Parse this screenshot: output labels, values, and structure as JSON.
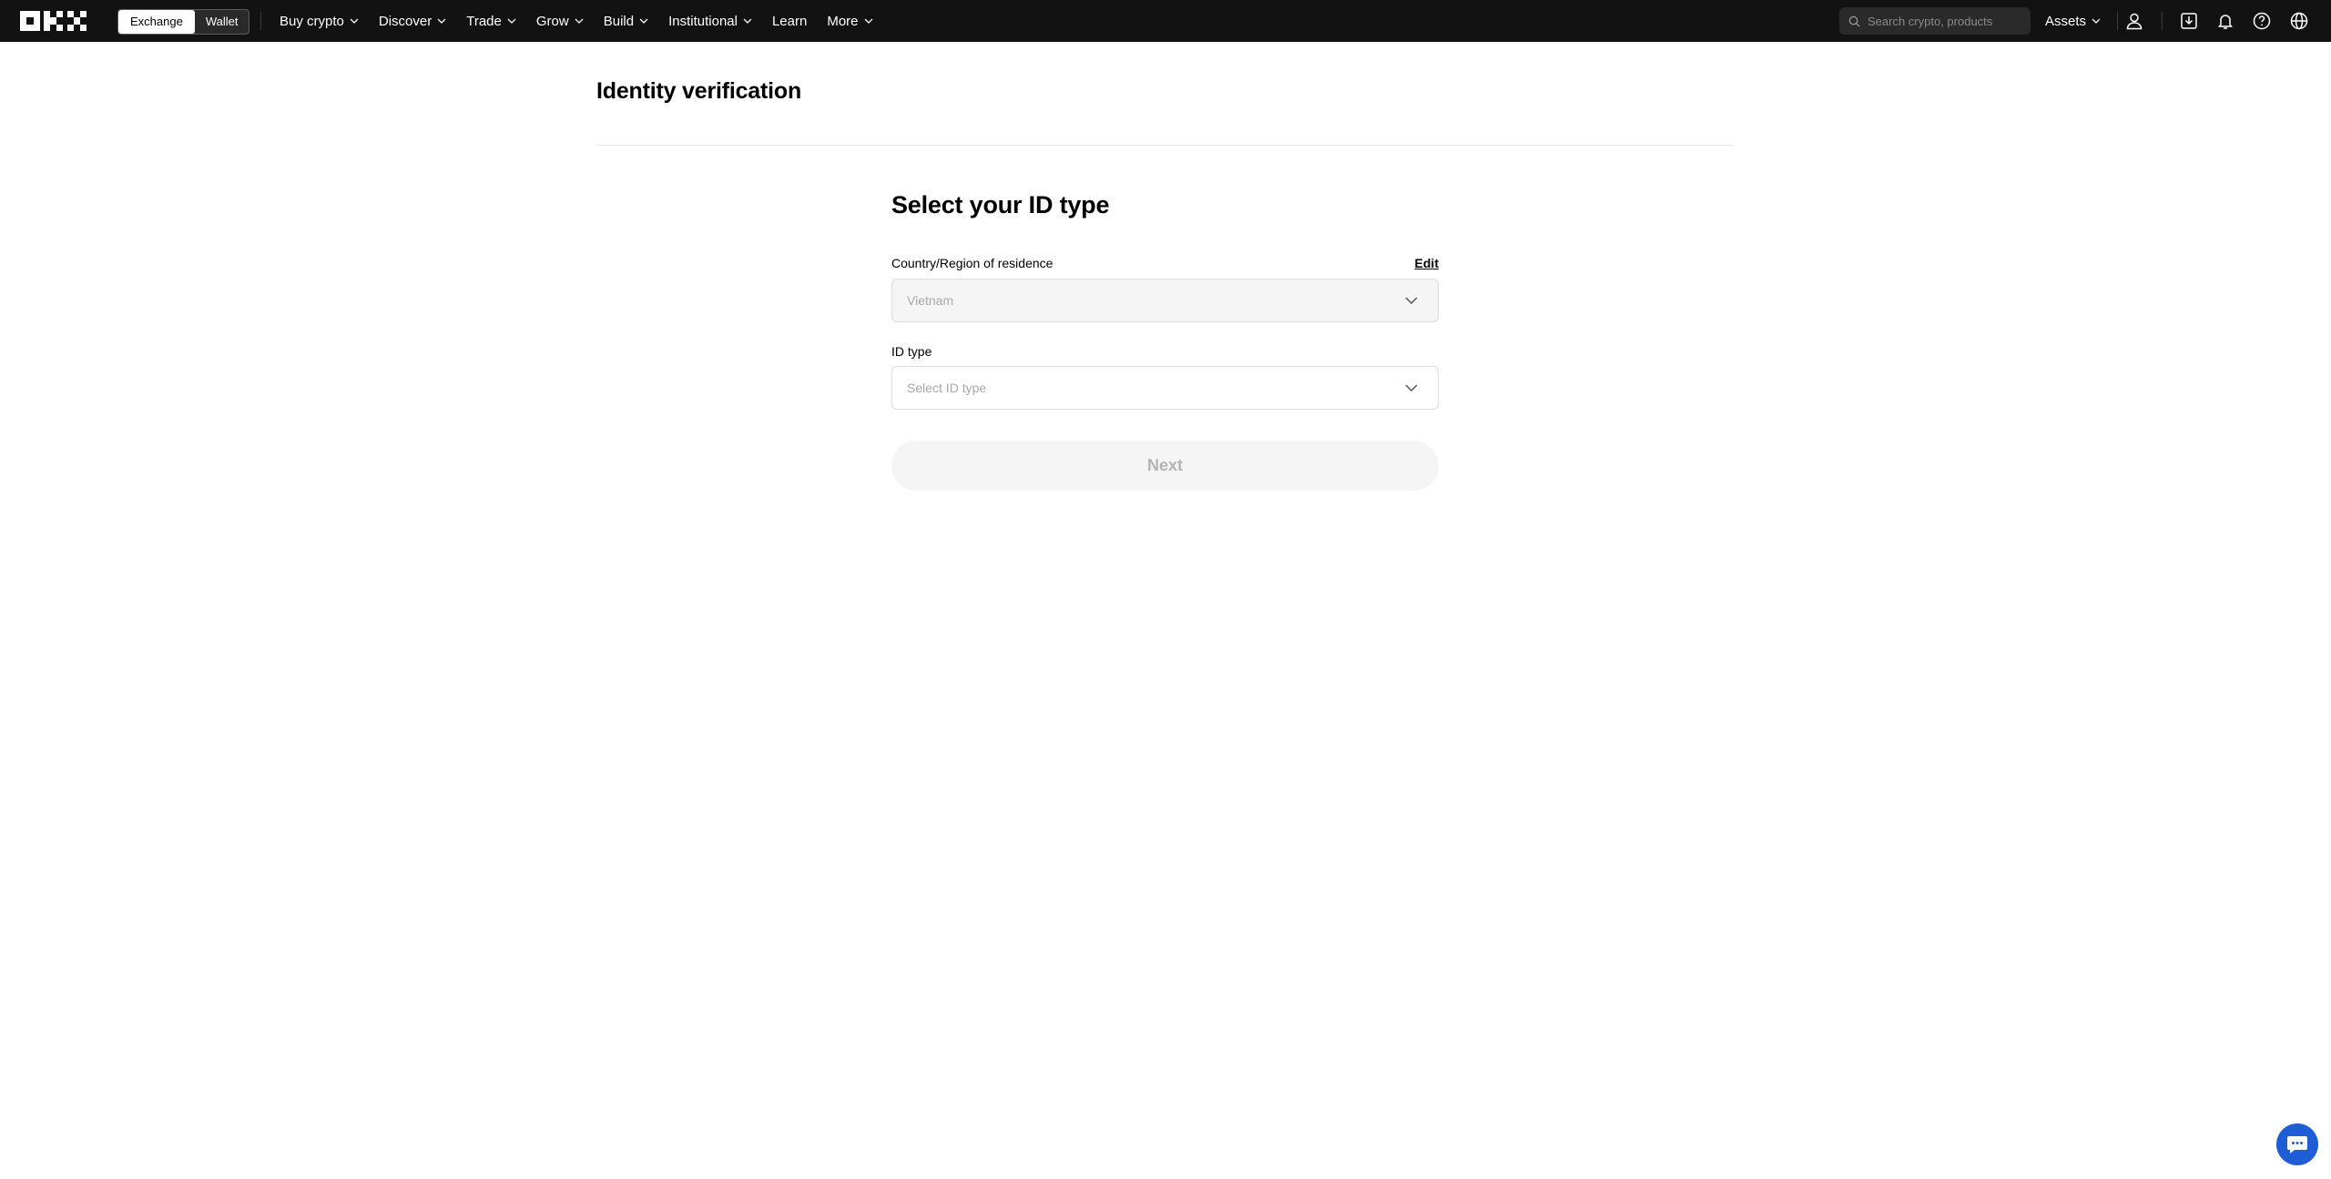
{
  "topbar": {
    "logo_text": "OKX",
    "mode_toggle": [
      {
        "label": "Exchange",
        "active": true
      },
      {
        "label": "Wallet",
        "active": false
      }
    ],
    "nav": [
      {
        "label": "Buy crypto",
        "has_dropdown": true
      },
      {
        "label": "Discover",
        "has_dropdown": true
      },
      {
        "label": "Trade",
        "has_dropdown": true
      },
      {
        "label": "Grow",
        "has_dropdown": true
      },
      {
        "label": "Build",
        "has_dropdown": true
      },
      {
        "label": "Institutional",
        "has_dropdown": true
      },
      {
        "label": "Learn",
        "has_dropdown": false
      },
      {
        "label": "More",
        "has_dropdown": true
      }
    ],
    "search_placeholder": "Search crypto, products",
    "assets_label": "Assets",
    "icons": [
      "user-icon",
      "download-icon",
      "bell-icon",
      "help-icon",
      "globe-icon"
    ]
  },
  "page": {
    "title": "Identity verification"
  },
  "form": {
    "title": "Select your ID type",
    "country_label": "Country/Region of residence",
    "edit_label": "Edit",
    "country_value": "Vietnam",
    "id_type_label": "ID type",
    "id_type_placeholder": "Select ID type",
    "next_label": "Next"
  },
  "colors": {
    "topbar_bg": "#121212",
    "chat_button": "#1f5dd6",
    "disabled_bg": "#f5f5f5"
  },
  "chat": {
    "icon": "chat-icon"
  }
}
